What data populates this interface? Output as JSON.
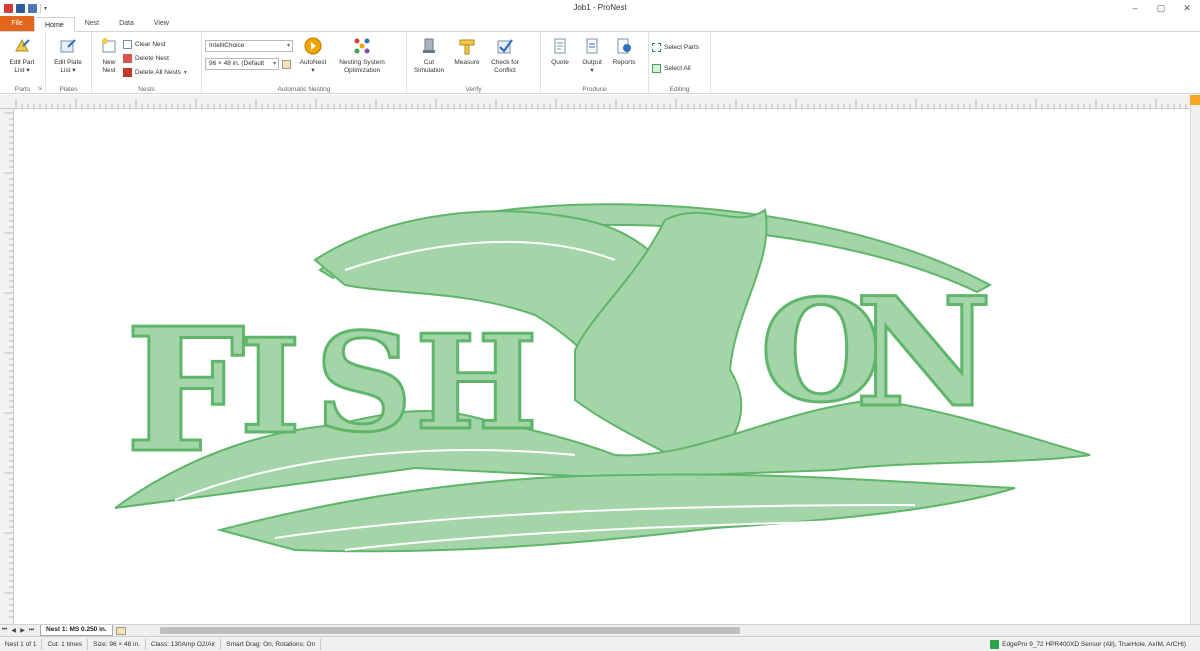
{
  "window": {
    "title": "Job1 - ProNest",
    "controls": [
      "–",
      "▢",
      "✕"
    ]
  },
  "qat": {
    "icons": [
      "pronest-logo-icon",
      "save-icon",
      "save-as-icon",
      "customize-icon"
    ]
  },
  "tabs": [
    "File",
    "Home",
    "Nest",
    "Data",
    "View"
  ],
  "active_tab": "Home",
  "ribbon": {
    "parts": {
      "label": "Parts",
      "edit_part_list": "Edit Part\nList ▾"
    },
    "plates": {
      "label": "Plates",
      "edit_plate_list": "Edit Plate\nList ▾"
    },
    "nests": {
      "label": "Nests",
      "new_nest": "New\nNest",
      "clear_nest": "Clear Nest",
      "delete_nest": "Delete Nest",
      "delete_all_nests": "Delete All Nests"
    },
    "automatic_nesting": {
      "label": "Automatic Nesting",
      "strategy": "IntelliChoice",
      "plate_size": "96 × 48 in. (Default",
      "autonest": "AutoNest\n▾",
      "optimization": "Nesting System\nOptimization"
    },
    "verify": {
      "label": "Verify",
      "cut_simulation": "Cut\nSimulation",
      "measure": "Measure",
      "check_conflict": "Check for\nConflict"
    },
    "produce": {
      "label": "Produce",
      "quote": "Quote",
      "output": "Output\n▾",
      "reports": "Reports"
    },
    "editing": {
      "label": "Editing",
      "select_parts": "Select Parts",
      "select_all": "Select All"
    }
  },
  "sheet_tab": "Nest 1: MS 0.250 in.",
  "status": {
    "nest": "Nest 1 of 1",
    "cut": "Cut: 1 times",
    "size": "Size: 96 × 48 in.",
    "class": "Class: 130Amp O2/Air",
    "drag": "Smart Drag: On, Rotations: On",
    "machine": "EdgePro 9_72 HPR400XD Sensor (All), TrueHole, AxIM, ArCHI)"
  },
  "canvas_text": {
    "fish": [
      "F",
      "I",
      "S",
      "H"
    ],
    "on": [
      "O",
      "N"
    ]
  },
  "colors": {
    "accent": "#e2661d",
    "part_fill": "#a4d5a9",
    "part_stroke": "#5fb56a"
  }
}
